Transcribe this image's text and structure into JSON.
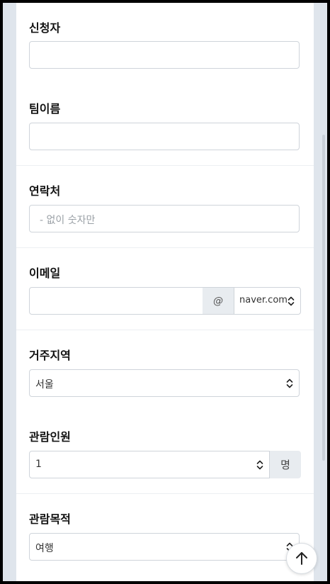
{
  "form": {
    "applicant": {
      "label": "신청자",
      "value": ""
    },
    "team_name": {
      "label": "팀이름",
      "value": ""
    },
    "contact": {
      "label": "연락처",
      "placeholder": "- 없이 숫자만",
      "value": ""
    },
    "email": {
      "label": "이메일",
      "local_value": "",
      "at_symbol": "@",
      "domain_selected": "naver.com"
    },
    "region": {
      "label": "거주지역",
      "selected": "서울"
    },
    "people": {
      "label": "관람인원",
      "value": "1",
      "unit": "명"
    },
    "purpose": {
      "label": "관람목적",
      "selected": "여행"
    }
  },
  "icons": {
    "select_arrow": "sort-updown-icon",
    "scroll_top": "arrow-up-icon"
  },
  "colors": {
    "border": "#cfd4da",
    "addon_bg": "#e8ecf0",
    "page_bg": "#dfe5ec"
  }
}
